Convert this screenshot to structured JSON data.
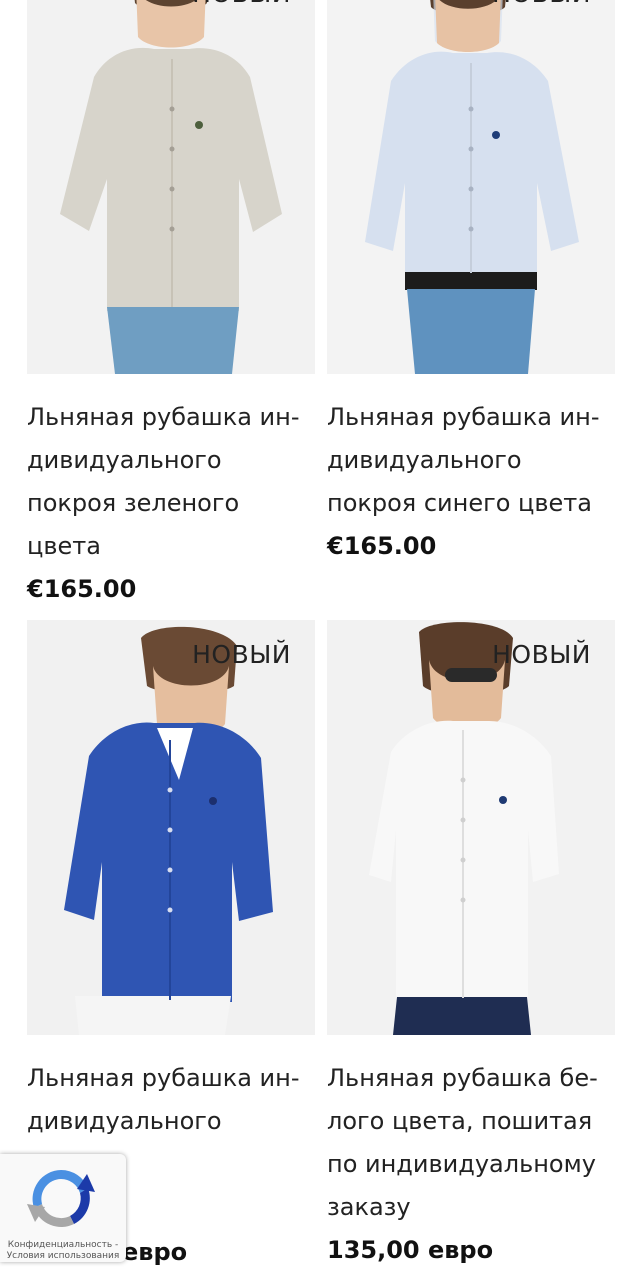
{
  "products": [
    {
      "badge": "НОВЫЙ",
      "title": "Льняная рубашка ин-дивидуального покроя зеленого цвета",
      "price": "€165.00",
      "shirt_color": "#d7d4cb",
      "pants_color": "#6f9ec2"
    },
    {
      "badge": "НОВЫЙ",
      "title": "Льняная рубашка ин-дивидуального покроя синего цвета",
      "price": "€165.00",
      "shirt_color": "#d6e0ef",
      "pants_color": "#5f92bf"
    },
    {
      "badge": "НОВЫЙ",
      "title": "Льняная рубашка ин-дивидуального покроя",
      "price": "евро",
      "shirt_color": "#2f55b3",
      "pants_color": "#f5f5f5"
    },
    {
      "badge": "НОВЫЙ",
      "title": "Льняная рубашка бе-лого цвета, пошитая по индивидуальному заказу",
      "price": "135,00 евро",
      "shirt_color": "#f8f8f8",
      "pants_color": "#1f2d52"
    }
  ],
  "recaptcha": {
    "privacy": "Конфиденциальность",
    "separator": "-",
    "terms": "Условия использования",
    "icon": "recaptcha-icon"
  }
}
